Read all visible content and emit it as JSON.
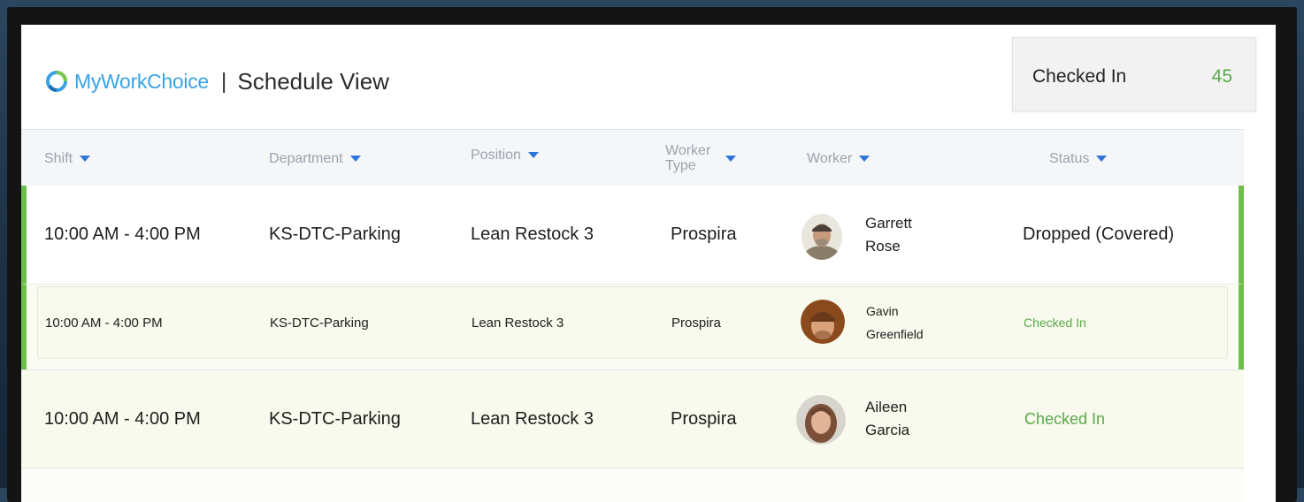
{
  "app": {
    "brand_name": "MyWorkChoice",
    "separator": "|",
    "page_title": "Schedule View",
    "brand_color": "#3aa3e3"
  },
  "summary": {
    "label": "Checked In",
    "count": "45",
    "count_color": "#5aa94a"
  },
  "table": {
    "columns": [
      {
        "key": "shift",
        "label": "Shift"
      },
      {
        "key": "department",
        "label": "Department"
      },
      {
        "key": "position",
        "label": "Position"
      },
      {
        "key": "worker_type",
        "label": "Worker Type"
      },
      {
        "key": "worker",
        "label": "Worker"
      },
      {
        "key": "status",
        "label": "Status"
      }
    ],
    "sort_icon": "caret-down-icon",
    "rows": [
      {
        "shift": "10:00 AM - 4:00 PM",
        "department": "KS-DTC-Parking",
        "position": "Lean Restock 3",
        "worker_type": "Prospira",
        "worker_first": "Garrett",
        "worker_last": "Rose",
        "status": "Dropped (Covered)",
        "status_color": "#1e1e1e"
      },
      {
        "shift": "10:00 AM - 4:00 PM",
        "department": "KS-DTC-Parking",
        "position": "Lean Restock 3",
        "worker_type": "Prospira",
        "worker_first": "Gavin",
        "worker_last": "Greenfield",
        "status": "Checked In",
        "status_color": "#5aa94a"
      },
      {
        "shift": "10:00 AM - 4:00 PM",
        "department": "KS-DTC-Parking",
        "position": "Lean Restock 3",
        "worker_type": "Prospira",
        "worker_first": "Aileen",
        "worker_last": "Garcia",
        "status": "Checked In",
        "status_color": "#5aa94a"
      }
    ]
  },
  "colors": {
    "accent_green": "#6cc04a",
    "row_highlight": "#f7faec",
    "header_bg": "#f4f6f8"
  }
}
